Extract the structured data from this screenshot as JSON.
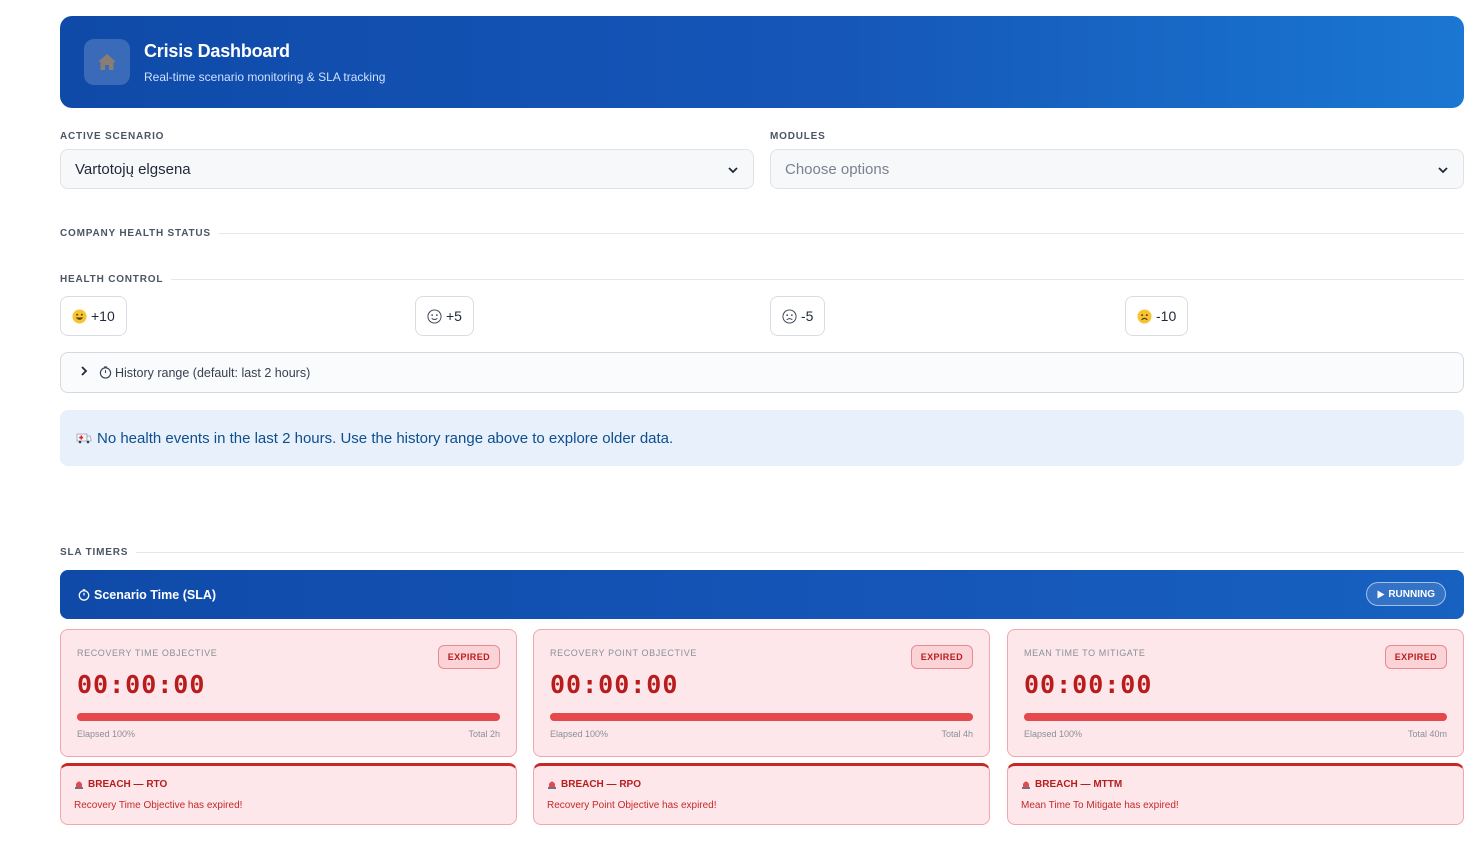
{
  "header": {
    "title": "Crisis Dashboard",
    "subtitle": "Real-time scenario monitoring & SLA tracking",
    "icon": "home-icon"
  },
  "scenario": {
    "label": "ACTIVE SCENARIO",
    "value": "Vartotojų elgsena"
  },
  "modules": {
    "label": "MODULES",
    "placeholder": "Choose options"
  },
  "sections": {
    "company_health": "COMPANY HEALTH STATUS",
    "health_control": "HEALTH CONTROL",
    "sla_timers": "SLA TIMERS"
  },
  "health_buttons": [
    {
      "label": "+10",
      "icon": "grinning-face-icon"
    },
    {
      "label": "+5",
      "icon": "slight-smile-icon"
    },
    {
      "label": "-5",
      "icon": "slight-frown-icon"
    },
    {
      "label": "-10",
      "icon": "worried-face-icon"
    }
  ],
  "history": {
    "label": "History range (default: last 2 hours)"
  },
  "info": {
    "message": "No health events in the last 2 hours. Use the history range above to explore older data."
  },
  "sla": {
    "title": "Scenario Time (SLA)",
    "status": "RUNNING",
    "timers": [
      {
        "title": "RECOVERY TIME OBJECTIVE",
        "badge": "EXPIRED",
        "time": "00:00:00",
        "elapsed_label": "Elapsed 100%",
        "elapsed_fraction": 1.0,
        "total_label": "Total 2h"
      },
      {
        "title": "RECOVERY POINT OBJECTIVE",
        "badge": "EXPIRED",
        "time": "00:00:00",
        "elapsed_label": "Elapsed 100%",
        "elapsed_fraction": 1.0,
        "total_label": "Total 4h"
      },
      {
        "title": "MEAN TIME TO MITIGATE",
        "badge": "EXPIRED",
        "time": "00:00:00",
        "elapsed_label": "Elapsed 100%",
        "elapsed_fraction": 1.0,
        "total_label": "Total 40m"
      }
    ],
    "breaches": [
      {
        "title": "BREACH — RTO",
        "message": "Recovery Time Objective has expired!"
      },
      {
        "title": "BREACH — RPO",
        "message": "Recovery Point Objective has expired!"
      },
      {
        "title": "BREACH — MTTM",
        "message": "Mean Time To Mitigate has expired!"
      }
    ]
  },
  "colors": {
    "primary": "#1556b8",
    "danger": "#b91c1c",
    "danger_bg": "#fde7ea",
    "info_bg": "#e7f0fb"
  }
}
